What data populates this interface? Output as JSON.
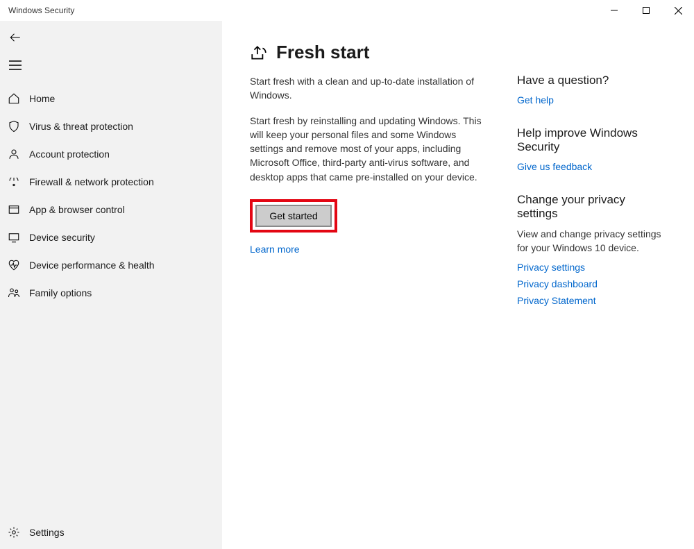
{
  "titlebar": {
    "title": "Windows Security"
  },
  "sidebar": {
    "items": [
      {
        "label": "Home"
      },
      {
        "label": "Virus & threat protection"
      },
      {
        "label": "Account protection"
      },
      {
        "label": "Firewall & network protection"
      },
      {
        "label": "App & browser control"
      },
      {
        "label": "Device security"
      },
      {
        "label": "Device performance & health"
      },
      {
        "label": "Family options"
      }
    ],
    "settings_label": "Settings"
  },
  "main": {
    "title": "Fresh start",
    "intro": "Start fresh with a clean and up-to-date installation of Windows.",
    "body": "Start fresh by reinstalling and updating Windows. This will keep your personal files and some Windows settings and remove most of your apps, including Microsoft Office, third-party anti-virus software, and desktop apps that came pre-installed on your device.",
    "get_started_label": "Get started",
    "learn_more": "Learn more"
  },
  "aside": {
    "question_heading": "Have a question?",
    "get_help": "Get help",
    "improve_heading": "Help improve Windows Security",
    "feedback": "Give us feedback",
    "privacy_heading": "Change your privacy settings",
    "privacy_text": "View and change privacy settings for your Windows 10 device.",
    "privacy_settings": "Privacy settings",
    "privacy_dashboard": "Privacy dashboard",
    "privacy_statement": "Privacy Statement"
  }
}
